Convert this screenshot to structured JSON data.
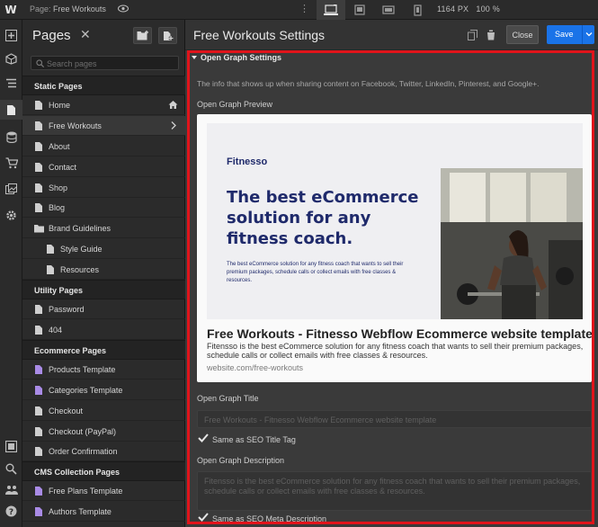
{
  "topbar": {
    "logo": "W",
    "page_label": "Page:",
    "page_name": "Free Workouts",
    "canvas_size": "1164 PX",
    "zoom": "100 %"
  },
  "pages_panel": {
    "title": "Pages",
    "search_placeholder": "Search pages",
    "sections": [
      {
        "label": "Static Pages",
        "items": [
          "Home",
          "Free Workouts",
          "About",
          "Contact",
          "Shop",
          "Blog",
          "Brand Guidelines",
          "Style Guide",
          "Resources"
        ]
      },
      {
        "label": "Utility Pages",
        "items": [
          "Password",
          "404"
        ]
      },
      {
        "label": "Ecommerce Pages",
        "items": [
          "Products Template",
          "Categories Template",
          "Checkout",
          "Checkout (PayPal)",
          "Order Confirmation"
        ]
      },
      {
        "label": "CMS Collection Pages",
        "items": [
          "Free Plans Template",
          "Authors Template"
        ]
      }
    ]
  },
  "settings": {
    "title": "Free Workouts Settings",
    "close_label": "Close",
    "save_label": "Save",
    "og_section": "Open Graph Settings",
    "og_description": "The info that shows up when sharing content on Facebook, Twitter, LinkedIn, Pinterest, and Google+.",
    "og_preview_label": "Open Graph Preview",
    "preview": {
      "brand": "Fitnesso",
      "headline": "The best eCommerce solution for any fitness coach.",
      "subline": "The best eCommerce solution for any fitness coach that wants to sell their premium packages, schedule calls or collect emails with free classes & resources.",
      "title": "Free Workouts - Fitnesso Webflow Ecommerce website template",
      "description": "Fitensso is the best eCommerce solution for any fitness coach that wants to sell their premium packages, schedule calls or collect emails with free classes & resources.",
      "url": "website.com/free-workouts"
    },
    "og_title_label": "Open Graph Title",
    "og_title_placeholder": "Free Workouts - Fitnesso Webflow Ecommerce website template",
    "same_as_title": "Same as SEO Title Tag",
    "og_desc_label": "Open Graph Description",
    "og_desc_placeholder": "Fitensso is the best eCommerce solution for any fitness coach that wants to sell their premium packages, schedule calls or collect emails with free classes & resources.",
    "same_as_desc": "Same as SEO Meta Description"
  },
  "colors": {
    "accent": "#1a73e8",
    "highlight_box": "#e0141b",
    "brand_navy": "#1f2a6b"
  }
}
